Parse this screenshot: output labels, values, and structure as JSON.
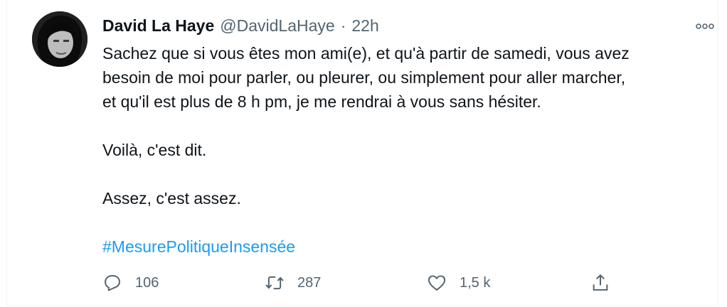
{
  "tweet": {
    "author_name": "David La Haye",
    "handle": "@DavidLaHaye",
    "separator": "·",
    "time": "22h",
    "lines": [
      "Sachez que si vous êtes mon ami(e), et qu'à partir de samedi, vous avez",
      "besoin de moi pour parler, ou pleurer, ou simplement pour aller marcher,",
      "et qu'il est plus de 8 h pm, je me rendrai à vous sans hésiter.",
      "Voilà, c'est dit.",
      "Assez, c'est assez."
    ],
    "hashtag": "#MesurePolitiqueInsensée"
  },
  "actions": {
    "reply_icon": "reply-icon",
    "reply_count": "106",
    "retweet_icon": "retweet-icon",
    "retweet_count": "287",
    "like_icon": "heart-icon",
    "like_count": "1,5 k",
    "share_icon": "share-icon"
  },
  "colors": {
    "text": "#0f1419",
    "secondary": "#536471",
    "link": "#1d9bf0"
  }
}
